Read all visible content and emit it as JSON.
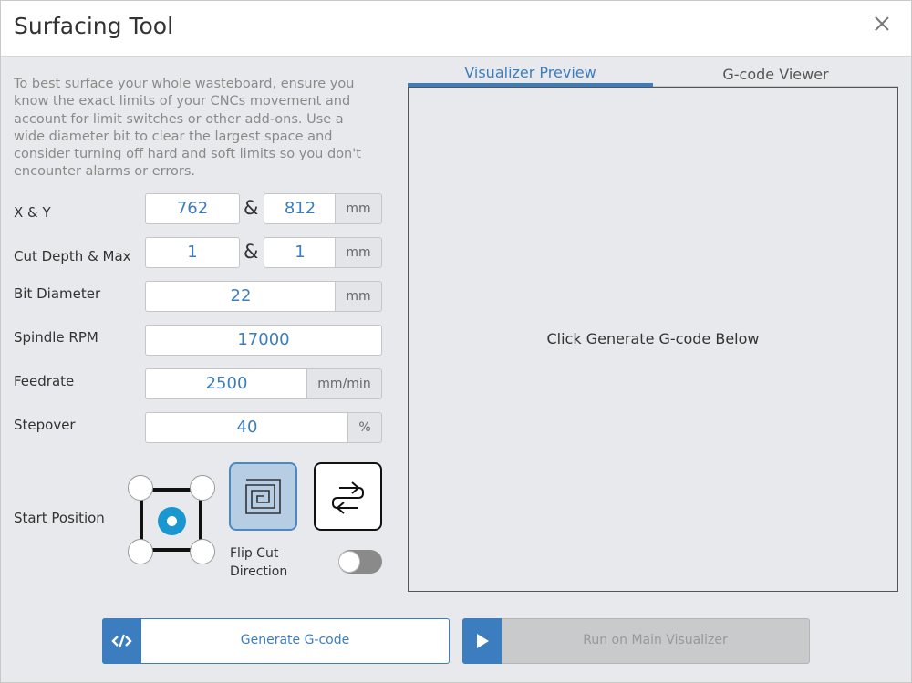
{
  "window": {
    "title": "Surfacing Tool"
  },
  "description": "To best surface your whole wasteboard, ensure you know the exact limits of your CNCs movement and account for limit switches or other add-ons. Use a wide diameter bit to clear the largest space and consider turning off hard and soft limits so you don't encounter alarms or errors.",
  "fields": {
    "xy": {
      "label": "X & Y",
      "x": "762",
      "y": "812",
      "sep": "&",
      "unit": "mm"
    },
    "cut_depth": {
      "label": "Cut Depth & Max",
      "depth": "1",
      "max": "1",
      "sep": "&",
      "unit": "mm"
    },
    "bit_diameter": {
      "label": "Bit Diameter",
      "value": "22",
      "unit": "mm"
    },
    "spindle_rpm": {
      "label": "Spindle RPM",
      "value": "17000"
    },
    "feedrate": {
      "label": "Feedrate",
      "value": "2500",
      "unit": "mm/min"
    },
    "stepover": {
      "label": "Stepover",
      "value": "40",
      "unit": "%"
    }
  },
  "start_position": {
    "label": "Start Position",
    "selected": "center"
  },
  "flip_cut": {
    "label_line1": "Flip Cut",
    "label_line2": "Direction",
    "enabled": false
  },
  "tabs": [
    {
      "label": "Visualizer Preview",
      "active": true
    },
    {
      "label": "G-code Viewer",
      "active": false
    }
  ],
  "visualizer": {
    "message": "Click Generate G-code Below"
  },
  "buttons": {
    "generate": "Generate G-code",
    "run": "Run on Main Visualizer"
  },
  "colors": {
    "accent": "#3c7dbf",
    "dot": "#1a96d1"
  }
}
